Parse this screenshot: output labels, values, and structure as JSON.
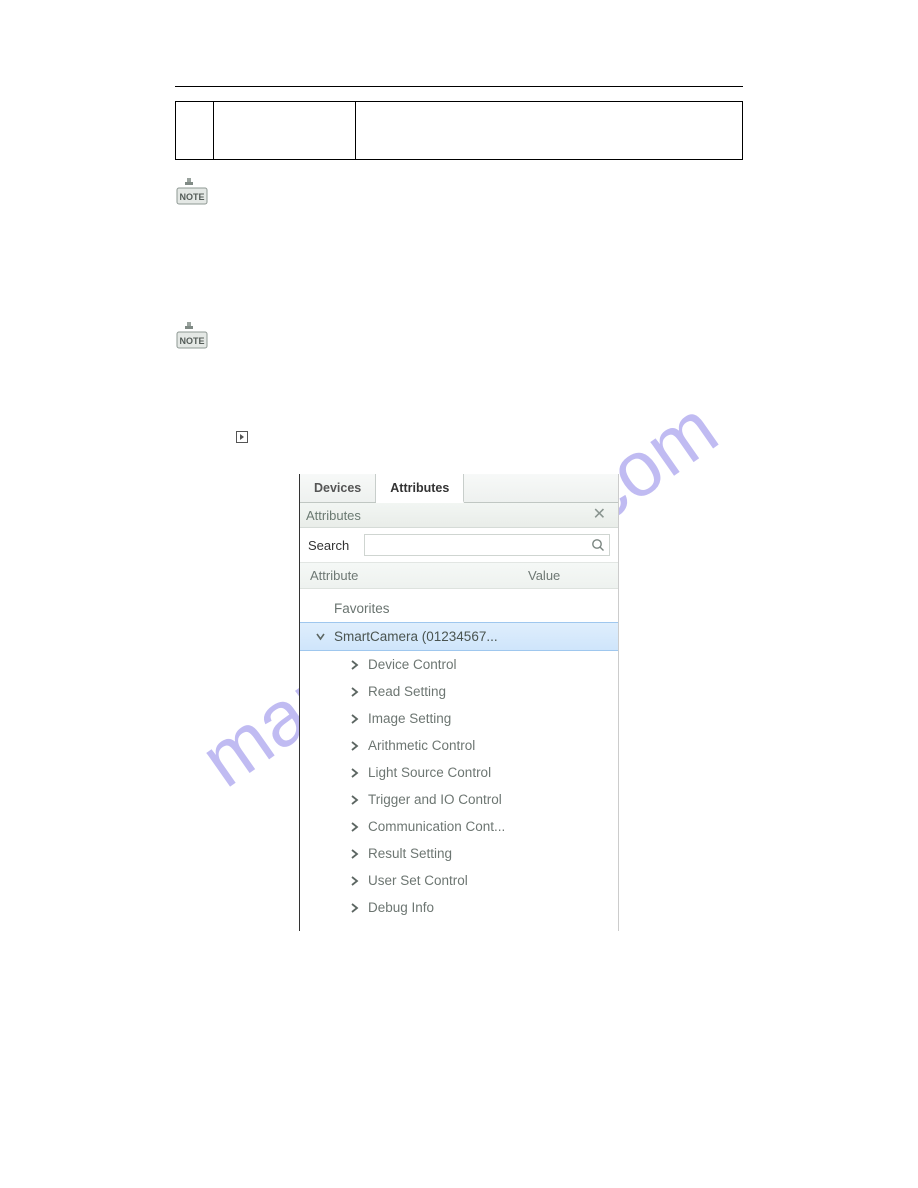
{
  "watermark": "manualshive.com",
  "ui": {
    "tabs": {
      "devices": "Devices",
      "attributes": "Attributes"
    },
    "titlebar": "Attributes",
    "search_label": "Search",
    "search_placeholder": "",
    "header": {
      "attribute": "Attribute",
      "value": "Value"
    },
    "favorites": "Favorites",
    "root": "SmartCamera (01234567...",
    "children": [
      "Device Control",
      "Read Setting",
      "Image Setting",
      "Arithmetic Control",
      "Light Source Control",
      "Trigger and IO Control",
      "Communication Cont...",
      "Result Setting",
      "User Set Control",
      "Debug Info"
    ]
  }
}
